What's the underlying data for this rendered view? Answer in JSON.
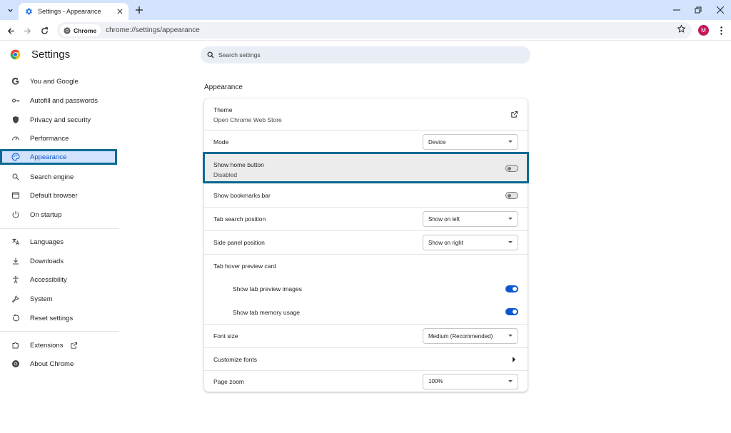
{
  "browser": {
    "tab_title": "Settings - Appearance",
    "chip_label": "Chrome",
    "url": "chrome://settings/appearance",
    "avatar_initial": "M"
  },
  "header": {
    "title": "Settings",
    "search_placeholder": "Search settings"
  },
  "sidebar": {
    "items": [
      {
        "label": "You and Google",
        "icon": "google-icon"
      },
      {
        "label": "Autofill and passwords",
        "icon": "key-icon"
      },
      {
        "label": "Privacy and security",
        "icon": "shield-icon"
      },
      {
        "label": "Performance",
        "icon": "speedometer-icon"
      },
      {
        "label": "Appearance",
        "icon": "palette-icon",
        "active": true
      },
      {
        "label": "Search engine",
        "icon": "search-icon"
      },
      {
        "label": "Default browser",
        "icon": "browser-window-icon"
      },
      {
        "label": "On startup",
        "icon": "power-icon"
      },
      {
        "label": "Languages",
        "icon": "translate-icon"
      },
      {
        "label": "Downloads",
        "icon": "download-icon"
      },
      {
        "label": "Accessibility",
        "icon": "accessibility-icon"
      },
      {
        "label": "System",
        "icon": "wrench-icon"
      },
      {
        "label": "Reset settings",
        "icon": "reset-icon"
      },
      {
        "label": "Extensions",
        "icon": "puzzle-icon"
      },
      {
        "label": "About Chrome",
        "icon": "chrome-icon"
      }
    ]
  },
  "content": {
    "section_title": "Appearance",
    "theme": {
      "label": "Theme",
      "sub": "Open Chrome Web Store"
    },
    "mode": {
      "label": "Mode",
      "value": "Device"
    },
    "home_button": {
      "label": "Show home button",
      "sub": "Disabled",
      "enabled": false
    },
    "bookmarks_bar": {
      "label": "Show bookmarks bar",
      "enabled": false
    },
    "tab_search_position": {
      "label": "Tab search position",
      "value": "Show on left"
    },
    "side_panel_position": {
      "label": "Side panel position",
      "value": "Show on right"
    },
    "tab_hover": {
      "label": "Tab hover preview card"
    },
    "tab_preview_images": {
      "label": "Show tab preview images",
      "enabled": true
    },
    "tab_memory_usage": {
      "label": "Show tab memory usage",
      "enabled": true
    },
    "font_size": {
      "label": "Font size",
      "value": "Medium (Recommended)"
    },
    "customize_fonts": {
      "label": "Customize fonts"
    },
    "page_zoom": {
      "label": "Page zoom",
      "value": "100%"
    }
  },
  "colors": {
    "accent": "#0b57d0",
    "highlight_border": "#0b6b94",
    "tabstrip": "#d3e3fd"
  }
}
